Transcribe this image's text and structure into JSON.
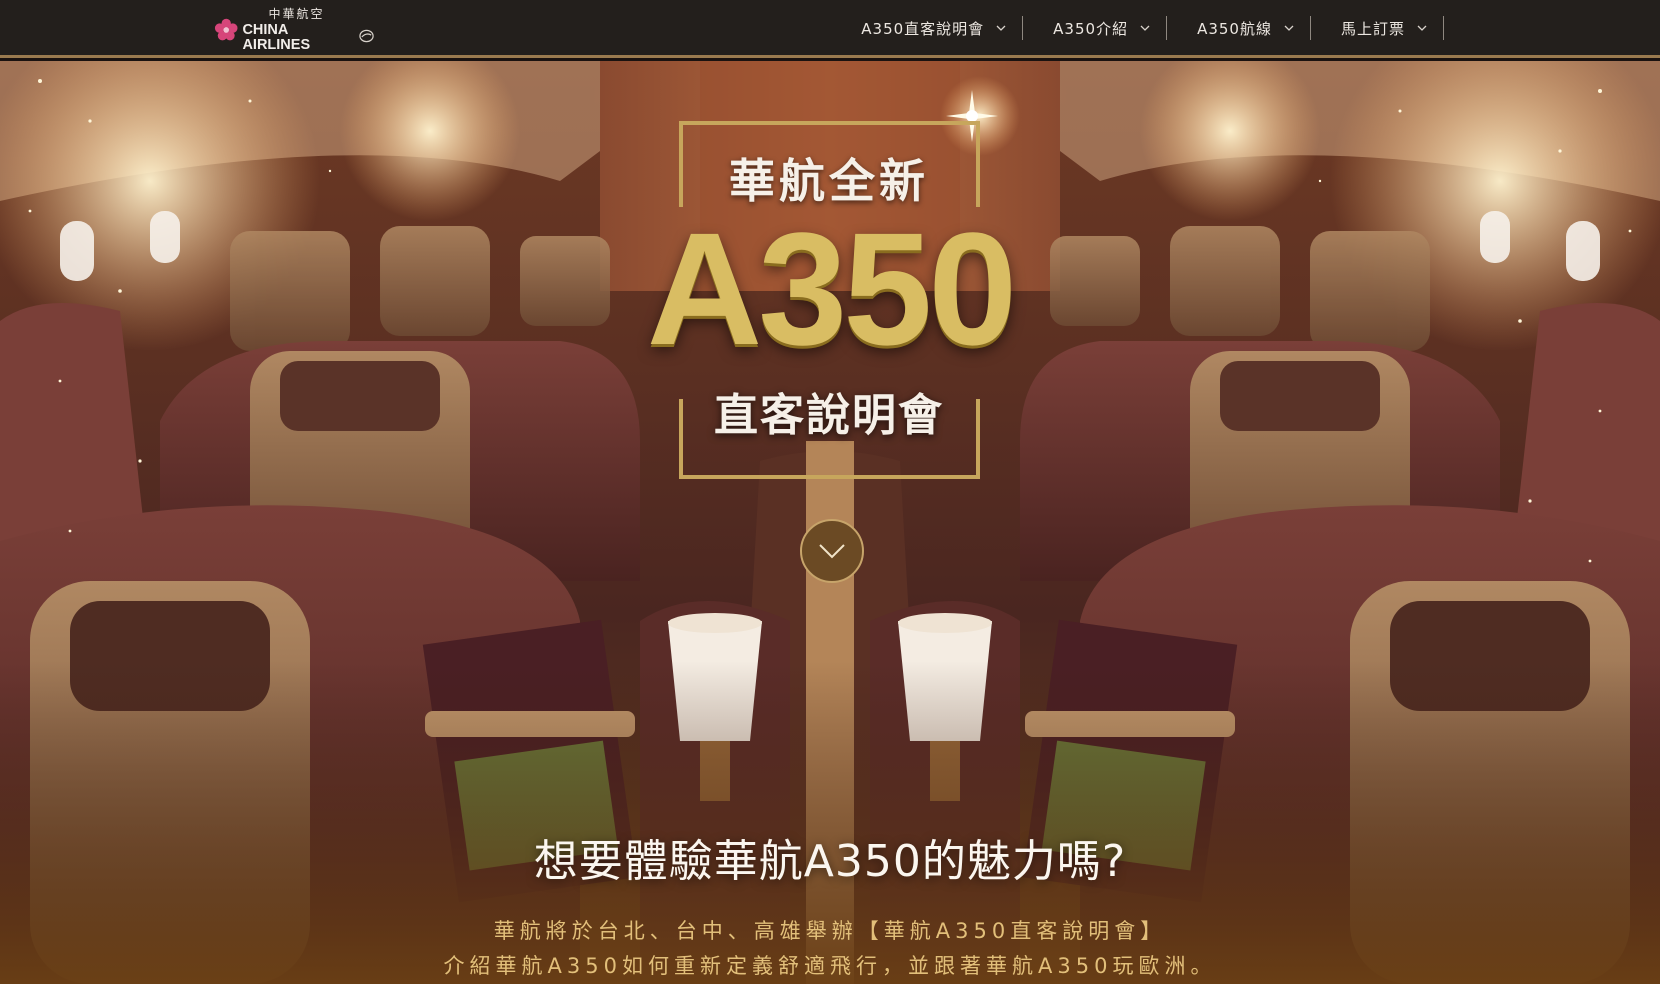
{
  "brand": {
    "logo_cn": "中華航空",
    "logo_en": "CHINA AIRLINES",
    "accent": "#9a7a4f",
    "bar_bg": "#231f1c"
  },
  "nav": {
    "items": [
      {
        "label": "A350直客說明會",
        "icon": "chevron-down-icon"
      },
      {
        "label": "A350介紹",
        "icon": "chevron-down-icon"
      },
      {
        "label": "A350航線",
        "icon": "chevron-down-icon"
      },
      {
        "label": "馬上訂票",
        "icon": "chevron-down-icon"
      }
    ]
  },
  "hero": {
    "title_top": "華航全新",
    "title_model": "A350",
    "title_bottom": "直客說明會",
    "scroll_icon": "chevron-down-icon",
    "headline": "想要體驗華航A350的魅力嗎?",
    "description_line1": "華航將於台北、台中、高雄舉辦【華航A350直客說明會】",
    "description_line2": "介紹華航A350如何重新定義舒適飛行，並跟著華航A350玩歐洲。",
    "gold": "#d9bd63",
    "text_gold": "#e2bf7a"
  }
}
